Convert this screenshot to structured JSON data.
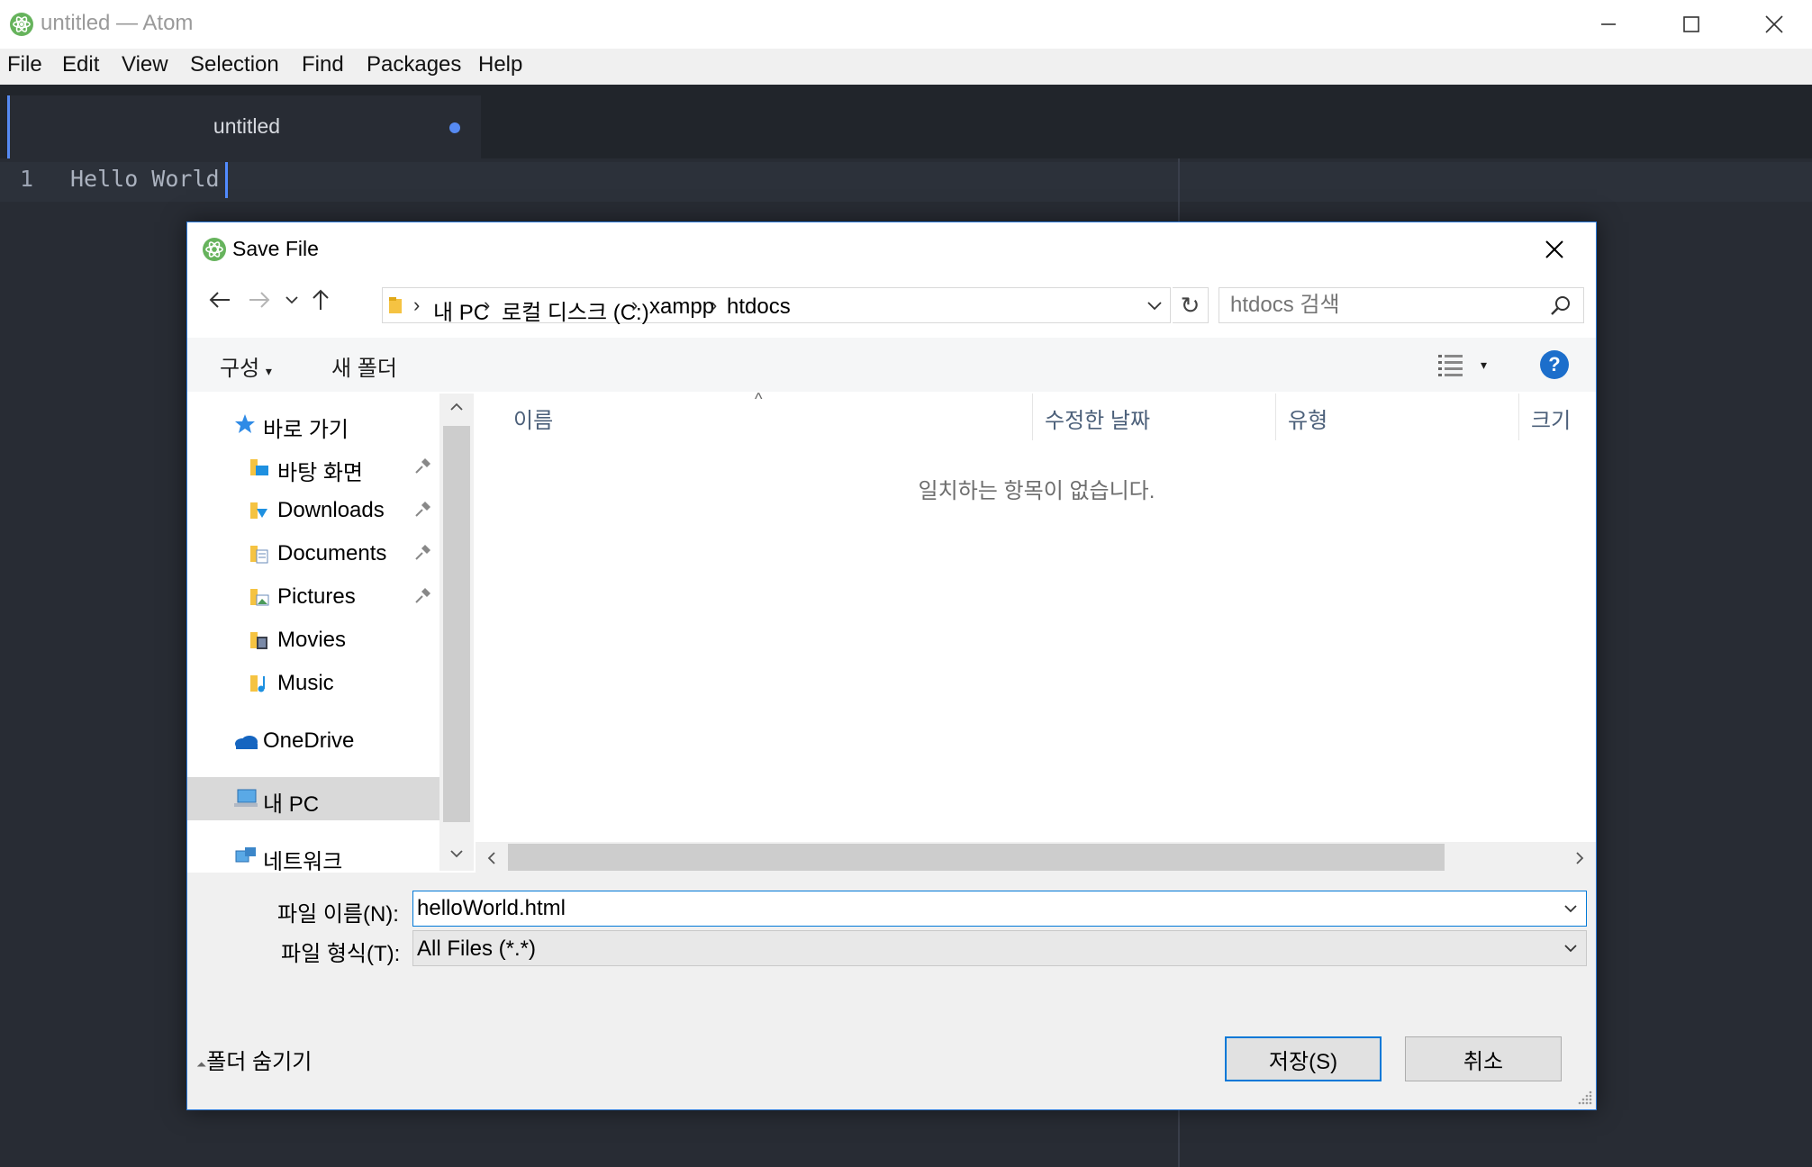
{
  "window": {
    "title": "untitled — Atom",
    "menu": [
      "File",
      "Edit",
      "View",
      "Selection",
      "Find",
      "Packages",
      "Help"
    ]
  },
  "editor": {
    "tab": {
      "label": "untitled",
      "modified": true
    },
    "lines": [
      {
        "number": "1",
        "text": "Hello World"
      }
    ]
  },
  "dialog": {
    "title": "Save File",
    "breadcrumb": [
      "내 PC",
      "로컬 디스크 (C:)",
      "xampp",
      "htdocs"
    ],
    "search_placeholder": "htdocs 검색",
    "toolbar": {
      "organize": "구성",
      "new_folder": "새 폴더"
    },
    "nav": {
      "quick_access": "바로 가기",
      "items": [
        {
          "label": "바탕 화면",
          "pinned": true
        },
        {
          "label": "Downloads",
          "pinned": true
        },
        {
          "label": "Documents",
          "pinned": true
        },
        {
          "label": "Pictures",
          "pinned": true
        },
        {
          "label": "Movies",
          "pinned": false
        },
        {
          "label": "Music",
          "pinned": false
        }
      ],
      "onedrive": "OneDrive",
      "this_pc": "내 PC",
      "network": "네트워크"
    },
    "columns": {
      "name": "이름",
      "modified": "수정한 날짜",
      "type": "유형",
      "size": "크기"
    },
    "empty_message": "일치하는 항목이 없습니다.",
    "filename_label": "파일 이름(N):",
    "filename_value": "helloWorld.html",
    "filetype_label": "파일 형식(T):",
    "filetype_value": "All Files (*.*)",
    "hide_folders": "폴더 숨기기",
    "save_button": "저장(S)",
    "cancel_button": "취소"
  },
  "colors": {
    "editor_bg": "#282c34",
    "accent": "#568af2",
    "dialog_border": "#2b79d8",
    "help_icon": "#1c6ecb"
  }
}
